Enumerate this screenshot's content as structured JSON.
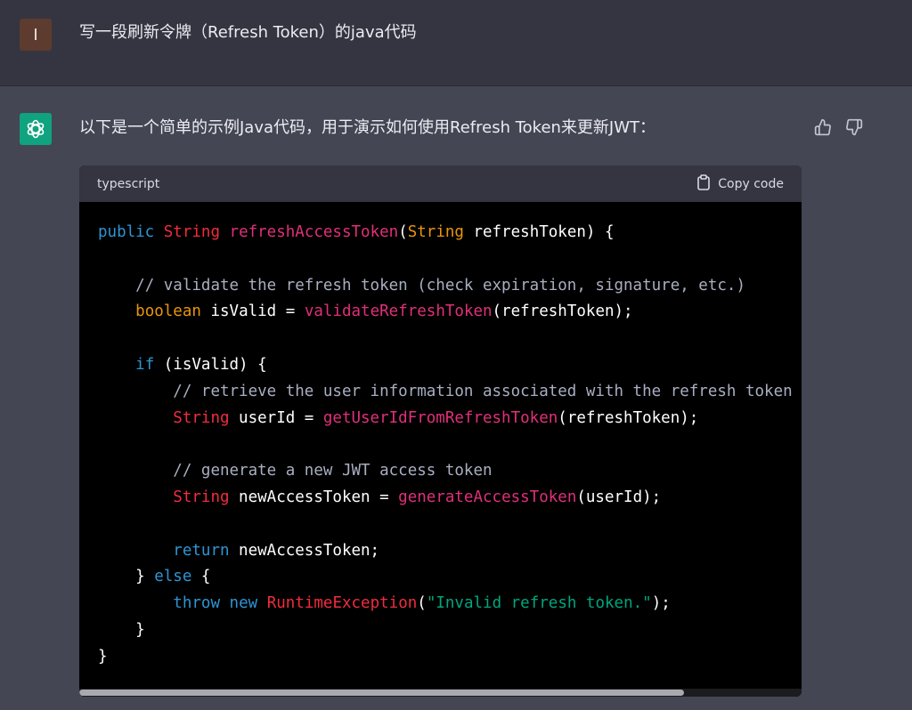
{
  "user_message": {
    "avatar_letter": "I",
    "text": "写一段刷新令牌（Refresh Token）的java代码"
  },
  "assistant_message": {
    "intro": "以下是一个简单的示例Java代码，用于演示如何使用Refresh Token来更新JWT：",
    "feedback": {
      "thumbs_up": "thumbs-up-icon",
      "thumbs_down": "thumbs-down-icon"
    },
    "code_block": {
      "language": "typescript",
      "copy_label": "Copy code",
      "lines": [
        [
          [
            "kw",
            "public"
          ],
          [
            "plain",
            " "
          ],
          [
            "type",
            "String"
          ],
          [
            "plain",
            " "
          ],
          [
            "fn",
            "refreshAccessToken"
          ],
          [
            "plain",
            "("
          ],
          [
            "bool",
            "String"
          ],
          [
            "plain",
            " refreshToken) {"
          ]
        ],
        [],
        [
          [
            "plain",
            "    "
          ],
          [
            "com",
            "// validate the refresh token (check expiration, signature, etc.)"
          ]
        ],
        [
          [
            "plain",
            "    "
          ],
          [
            "bool",
            "boolean"
          ],
          [
            "plain",
            " isValid = "
          ],
          [
            "fn",
            "validateRefreshToken"
          ],
          [
            "plain",
            "(refreshToken);"
          ]
        ],
        [],
        [
          [
            "plain",
            "    "
          ],
          [
            "kw",
            "if"
          ],
          [
            "plain",
            " (isValid) {"
          ]
        ],
        [
          [
            "plain",
            "        "
          ],
          [
            "com",
            "// retrieve the user information associated with the refresh token ("
          ]
        ],
        [
          [
            "plain",
            "        "
          ],
          [
            "type",
            "String"
          ],
          [
            "plain",
            " userId = "
          ],
          [
            "fn",
            "getUserIdFromRefreshToken"
          ],
          [
            "plain",
            "(refreshToken);"
          ]
        ],
        [],
        [
          [
            "plain",
            "        "
          ],
          [
            "com",
            "// generate a new JWT access token"
          ]
        ],
        [
          [
            "plain",
            "        "
          ],
          [
            "type",
            "String"
          ],
          [
            "plain",
            " newAccessToken = "
          ],
          [
            "fn",
            "generateAccessToken"
          ],
          [
            "plain",
            "(userId);"
          ]
        ],
        [],
        [
          [
            "plain",
            "        "
          ],
          [
            "kw",
            "return"
          ],
          [
            "plain",
            " newAccessToken;"
          ]
        ],
        [
          [
            "plain",
            "    } "
          ],
          [
            "kw",
            "else"
          ],
          [
            "plain",
            " {"
          ]
        ],
        [
          [
            "plain",
            "        "
          ],
          [
            "kw",
            "throw"
          ],
          [
            "plain",
            " "
          ],
          [
            "kw",
            "new"
          ],
          [
            "plain",
            " "
          ],
          [
            "type",
            "RuntimeException"
          ],
          [
            "plain",
            "("
          ],
          [
            "str",
            "\"Invalid refresh token.\""
          ],
          [
            "plain",
            ");"
          ]
        ],
        [
          [
            "plain",
            "    }"
          ]
        ],
        [
          [
            "plain",
            "}"
          ]
        ]
      ]
    }
  },
  "colors": {
    "page_bg": "#444654",
    "user_row_bg": "#343541",
    "code_bg": "#000000",
    "gpt_avatar": "#10a37f",
    "user_avatar": "#5e3b2f"
  }
}
